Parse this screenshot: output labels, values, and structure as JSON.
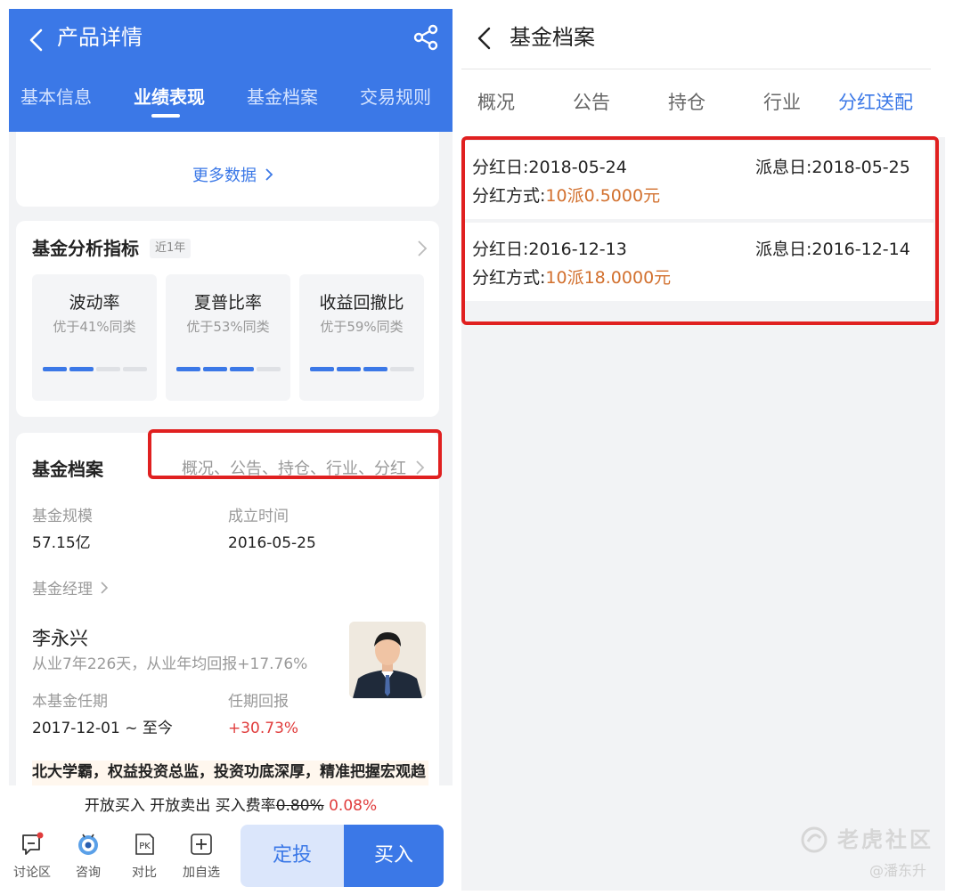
{
  "left": {
    "header_title": "产品详情",
    "tabs": [
      {
        "label": "基本信息"
      },
      {
        "label": "业绩表现",
        "active": true
      },
      {
        "label": "基金档案"
      },
      {
        "label": "交易规则"
      }
    ],
    "more_data": "更多数据",
    "analysis": {
      "title": "基金分析指标",
      "badge": "近1年",
      "metrics": [
        {
          "name": "波动率",
          "sub": "优于41%同类",
          "level": 2,
          "max": 4
        },
        {
          "name": "夏普比率",
          "sub": "优于53%同类",
          "level": 3,
          "max": 4
        },
        {
          "name": "收益回撤比",
          "sub": "优于59%同类",
          "level": 3,
          "max": 4
        }
      ]
    },
    "archive": {
      "title": "基金档案",
      "links": "概况、公告、持仓、行业、分红",
      "scale_label": "基金规模",
      "scale_value": "57.15亿",
      "founded_label": "成立时间",
      "founded_value": "2016-05-25"
    },
    "manager": {
      "header": "基金经理",
      "name": "李永兴",
      "desc": "从业7年226天，从业年均回报+17.76%",
      "tenure_label": "本基金任期",
      "tenure_value": "2017-12-01 ~ 至今",
      "return_label": "任期回报",
      "return_value": "+30.73%",
      "quote": "北大学霸，权益投资总监，投资功底深厚，精准把握宏观趋势，专注于行业优选个股"
    },
    "bottom": {
      "fee_prefix": "开放买入 开放卖出  买入费率",
      "fee_old": "0.80%",
      "fee_new": "0.08%",
      "items": [
        {
          "label": "讨论区",
          "icon": "chat-icon"
        },
        {
          "label": "咨询",
          "icon": "robot-icon"
        },
        {
          "label": "对比",
          "icon": "pk-icon"
        },
        {
          "label": "加自选",
          "icon": "plus-square-icon"
        }
      ],
      "dingtou": "定投",
      "buy": "买入"
    }
  },
  "right": {
    "header_title": "基金档案",
    "tabs": [
      {
        "label": "概况"
      },
      {
        "label": "公告"
      },
      {
        "label": "持仓"
      },
      {
        "label": "行业"
      },
      {
        "label": "分红送配",
        "active": true
      }
    ],
    "dividends": [
      {
        "date_label": "分红日:",
        "date": "2018-05-24",
        "pay_label": "派息日:",
        "pay": "2018-05-25",
        "way_label": "分红方式:",
        "way": "10派0.5000元"
      },
      {
        "date_label": "分红日:",
        "date": "2016-12-13",
        "pay_label": "派息日:",
        "pay": "2016-12-14",
        "way_label": "分红方式:",
        "way": "10派18.0000元"
      }
    ]
  },
  "watermark": {
    "brand": "老虎社区",
    "user": "@潘东升"
  },
  "colors": {
    "brand_blue": "#3b78e7",
    "highlight_red": "#e02020",
    "dividend_orange": "#d2702e",
    "return_red": "#e03c3c"
  }
}
